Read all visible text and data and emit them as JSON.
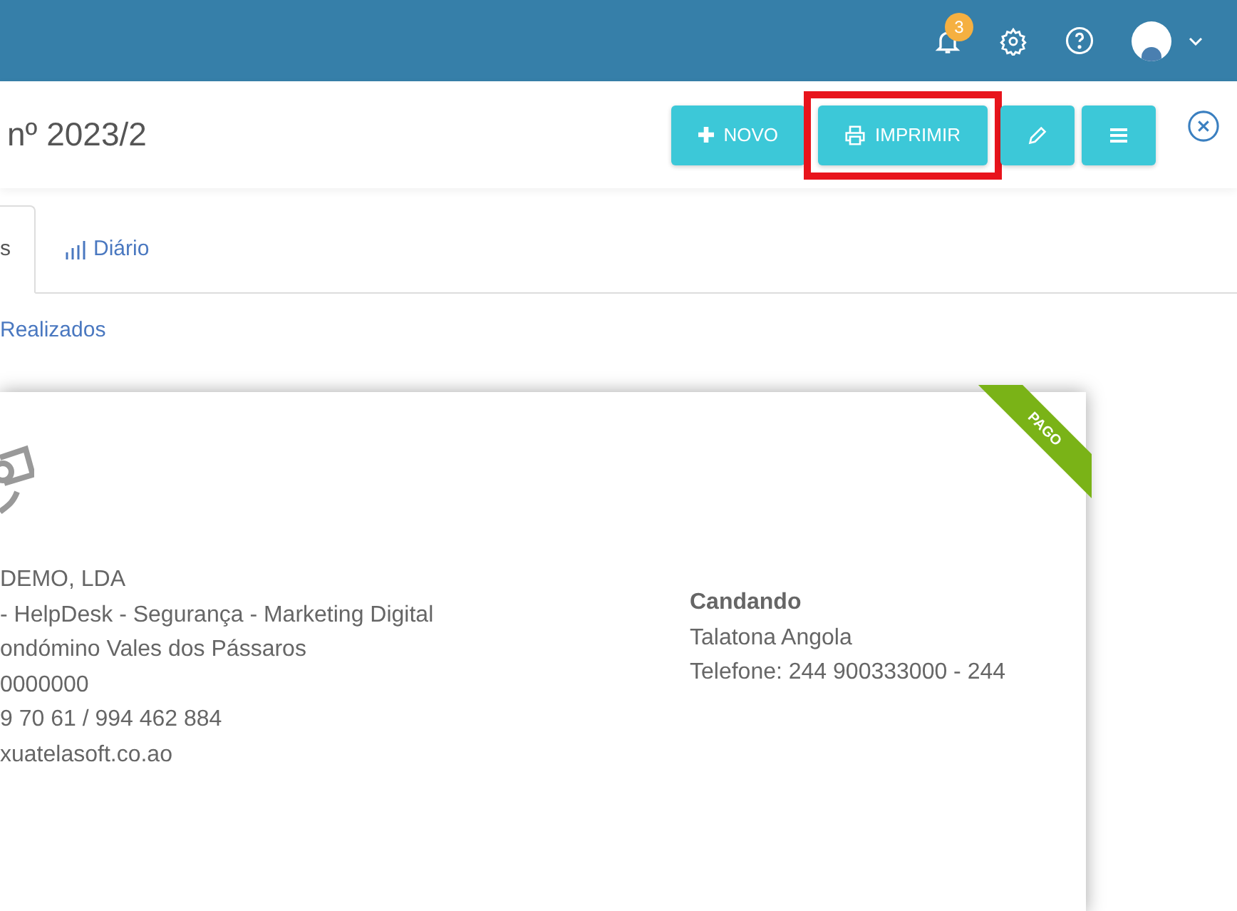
{
  "topbar": {
    "notification_count": "3"
  },
  "header": {
    "title": "nº 2023/2",
    "buttons": [
      {
        "kind": "plus",
        "label": "NOVO",
        "highlighted": false
      },
      {
        "kind": "print",
        "label": "IMPRIMIR",
        "highlighted": true
      },
      {
        "kind": "edit",
        "highlighted": false
      },
      {
        "kind": "menu",
        "highlighted": false
      }
    ]
  },
  "tabs": [
    {
      "label": "s",
      "selected": true
    },
    {
      "label": "Diário",
      "selected": false
    }
  ],
  "link": "Realizados",
  "document": {
    "ribbon": "PAGO",
    "company_lines": [
      "DEMO, LDA",
      "- HelpDesk - Segurança - Marketing Digital",
      "ondómino Vales dos Pássaros",
      "0000000",
      "9 70 61 / 994 462 884",
      "xuatelasoft.co.ao"
    ],
    "client_name": "Candando",
    "client_lines": [
      "Talatona Angola",
      "Telefone: 244 900333000 - 244"
    ]
  }
}
